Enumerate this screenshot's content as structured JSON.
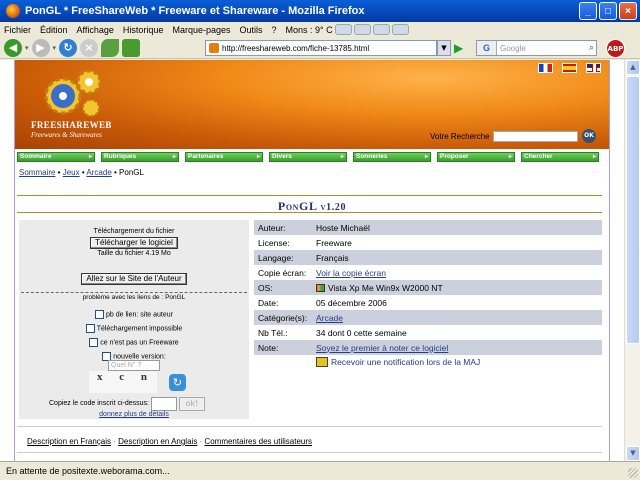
{
  "window": {
    "title": "PonGL * FreeShareWeb * Freeware et Shareware - Mozilla Firefox"
  },
  "menu": {
    "items": [
      "Fichier",
      "Édition",
      "Affichage",
      "Historique",
      "Marque-pages",
      "Outils",
      "?"
    ],
    "weather": "Mons : 9° C"
  },
  "nav": {
    "url": "http://freeshareweb.com/fiche-13785.html",
    "search_placeholder": "Google"
  },
  "site": {
    "logo_name": "FREESHAREWEB",
    "logo_tagline": "Freewares & Sharewares",
    "search_label": "Votre Recherche",
    "search_ok": "OK",
    "categories": [
      "Sommaire",
      "Rubriques",
      "Partenaires",
      "Divers",
      "Sonneries",
      "Proposer",
      "Chercher"
    ],
    "breadcrumb": {
      "home": "Sommaire",
      "cat": "Jeux",
      "sub": "Arcade",
      "current": "PonGL"
    },
    "title": "PonGL",
    "version": "v1.20"
  },
  "download": {
    "heading": "Téléchargement du fichier",
    "button": "Télécharger le logiciel",
    "size": "Taille du fichier 4.19 Mo",
    "author_button": "Allez sur le Site de l'Auteur",
    "problem_title": "problème avec les liens de : PonGL",
    "options": [
      "pb de lien: site auteur",
      "Téléchargement impossible",
      "ce n'est pas un Freeware",
      "nouvelle version:"
    ],
    "version_placeholder": "Quel N° ?",
    "captcha": "x c n",
    "code_label": "Copiez le code inscrit ci-dessus:",
    "ok": "ok!",
    "more": "donnez plus de détails"
  },
  "info": [
    {
      "key": "Auteur:",
      "value": "Hoste Michaël"
    },
    {
      "key": "License:",
      "value": "Freeware"
    },
    {
      "key": "Langage:",
      "value": "Français"
    },
    {
      "key": "Copie écran:",
      "value": "Voir la copie écran"
    },
    {
      "key": "OS:",
      "value": "Vista Xp Me Win9x W2000 NT"
    },
    {
      "key": "Date:",
      "value": "05 décembre 2006"
    },
    {
      "key": "Catégorie(s):",
      "value": "Arcade"
    },
    {
      "key": "Nb Tél.:",
      "value": "34 dont 0 cette semaine"
    },
    {
      "key": "Note:",
      "value": "Soyez le premier à noter ce logiciel"
    }
  ],
  "notification": "Recevoir une notification lors de la MAJ",
  "tabs": [
    "Description en Français",
    "Description en Anglais",
    "Commentaires des utilisateurs"
  ],
  "status": "En attente de positexte.weborama.com..."
}
